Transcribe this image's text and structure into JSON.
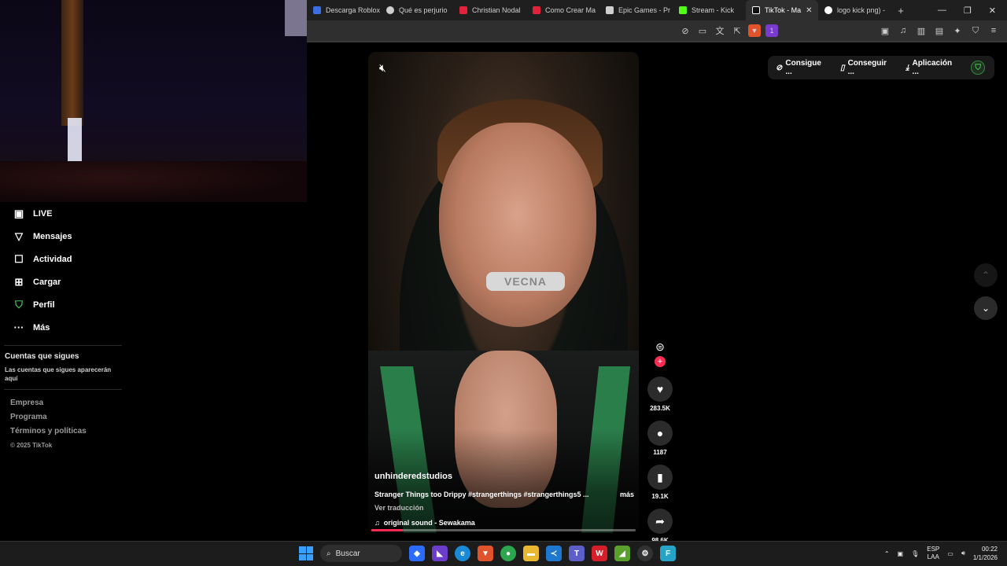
{
  "browser": {
    "tabs": [
      {
        "label": "Descarga Roblox",
        "color": "#3b6ee0",
        "active": false
      },
      {
        "label": "Qué es perjurio",
        "color": "#cfcfcf",
        "active": false
      },
      {
        "label": "Christian Nodal",
        "color": "#e0223a",
        "active": false
      },
      {
        "label": "Como Crear Ma",
        "color": "#e0223a",
        "active": false
      },
      {
        "label": "Epic Games - Pr",
        "color": "#cfcfcf",
        "active": false
      },
      {
        "label": "Stream - Kick",
        "color": "#53fc18",
        "active": false
      },
      {
        "label": "TikTok - Ma",
        "color": "#ffffff",
        "active": true
      },
      {
        "label": "logo kick png) -",
        "color": "#ffffff",
        "active": false
      }
    ],
    "new_tab": "+",
    "brave_badge": "1"
  },
  "sidebar": {
    "items": [
      {
        "label": "LIVE",
        "icon": "live-icon"
      },
      {
        "label": "Mensajes",
        "icon": "messages-icon"
      },
      {
        "label": "Actividad",
        "icon": "activity-icon"
      },
      {
        "label": "Cargar",
        "icon": "upload-icon"
      },
      {
        "label": "Perfil",
        "icon": "profile-icon"
      },
      {
        "label": "Más",
        "icon": "more-icon"
      }
    ],
    "following_title": "Cuentas que sigues",
    "following_text": "Las cuentas que sigues aparecerán aquí",
    "footer": {
      "empresa": "Empresa",
      "programa": "Programa",
      "terminos": "Términos y políticas",
      "copyright": "© 2025 TikTok"
    }
  },
  "video": {
    "author": "unhinderedstudios",
    "caption": "Stranger Things too Drippy #strangerthings #strangerthings5 ...",
    "more": "más",
    "translate": "Ver traducción",
    "sound": "original sound - Sewakama",
    "grill_text": "VECNA",
    "progress_fraction": 0.12
  },
  "actions": {
    "likes": "283.5K",
    "comments": "1187",
    "saves": "19.1K",
    "shares": "98.6K"
  },
  "top_bar": {
    "get_coins": "Consigue ...",
    "get_app": "Conseguir ...",
    "download": "Aplicación ..."
  },
  "taskbar": {
    "search": "Buscar",
    "lang_top": "ESP",
    "lang_bottom": "LAA",
    "time": "00:22",
    "date": "1/1/2026"
  }
}
